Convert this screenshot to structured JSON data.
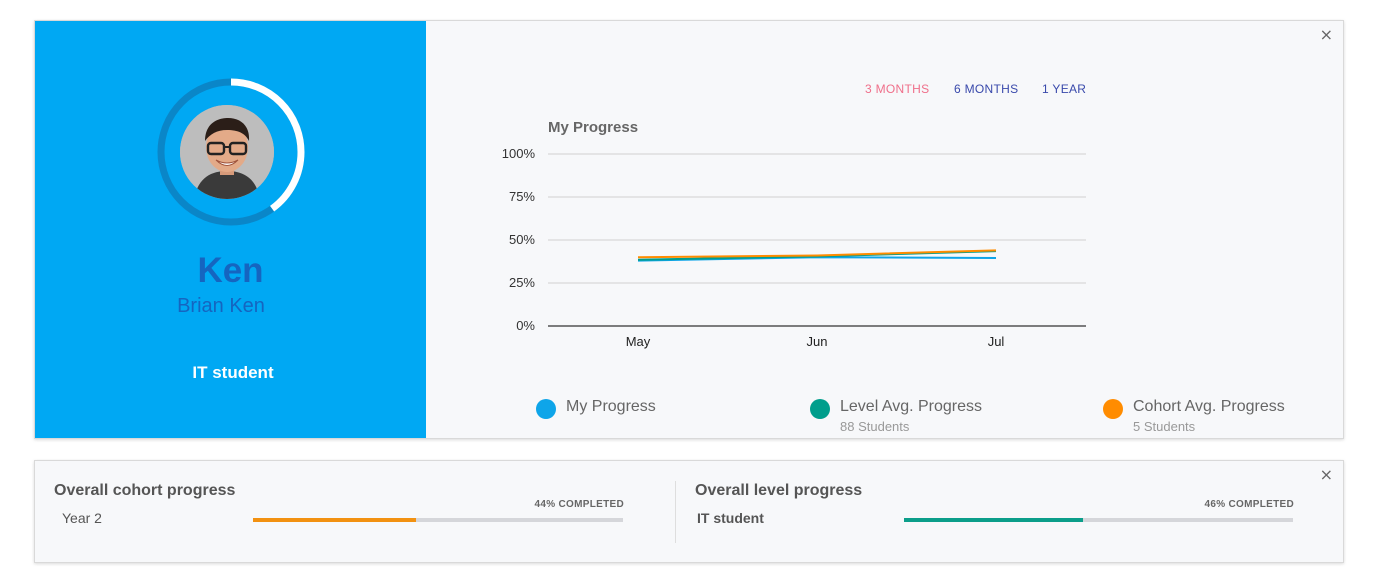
{
  "profile": {
    "nickname": "Ken",
    "fullname": "Brian Ken",
    "role": "IT student",
    "ring_progress_percent": 40
  },
  "range_buttons": [
    {
      "label": "3 MONTHS",
      "color": "#ef6f8a"
    },
    {
      "label": "6 MONTHS",
      "color": "#3949ab"
    },
    {
      "label": "1 YEAR",
      "color": "#3949ab"
    }
  ],
  "legend": [
    {
      "label": "My Progress",
      "sub": "",
      "color": "#0ea5e9"
    },
    {
      "label": "Level Avg. Progress",
      "sub": "88 Students",
      "color": "#009e8c"
    },
    {
      "label": "Cohort Avg. Progress",
      "sub": "5 Students",
      "color": "#ff8c00"
    }
  ],
  "chart_data": {
    "type": "line",
    "title": "My Progress",
    "categories": [
      "May",
      "Jun",
      "Jul"
    ],
    "y_ticks": [
      "0%",
      "25%",
      "50%",
      "75%",
      "100%"
    ],
    "ylim": [
      0,
      100
    ],
    "grid": true,
    "series": [
      {
        "name": "My Progress",
        "color": "#0ea5e9",
        "values": [
          38,
          40,
          39.5
        ]
      },
      {
        "name": "Level Avg. Progress",
        "color": "#009e8c",
        "values": [
          38.5,
          40.5,
          43.5
        ]
      },
      {
        "name": "Cohort Avg. Progress",
        "color": "#ff8c00",
        "values": [
          40,
          41,
          44
        ]
      }
    ]
  },
  "cohort": {
    "title": "Overall cohort progress",
    "sub": "Year 2",
    "completed_text": "44% COMPLETED",
    "percent": 44,
    "color": "#f29111"
  },
  "level": {
    "title": "Overall level progress",
    "sub": "IT student",
    "completed_text": "46% COMPLETED",
    "percent": 46,
    "color": "#0c9e8a"
  },
  "close_symbol": "×"
}
